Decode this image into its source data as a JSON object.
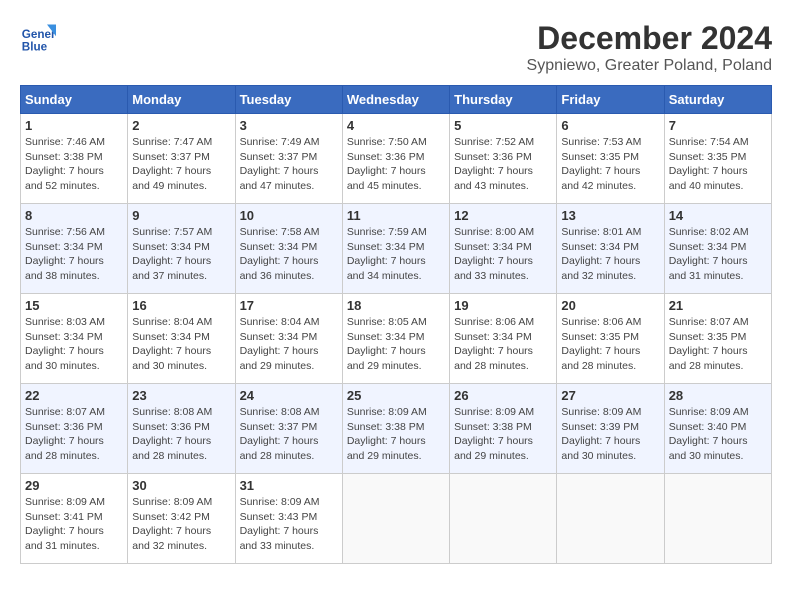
{
  "logo": {
    "text_line1": "General",
    "text_line2": "Blue"
  },
  "header": {
    "month": "December 2024",
    "location": "Sypniewo, Greater Poland, Poland"
  },
  "weekdays": [
    "Sunday",
    "Monday",
    "Tuesday",
    "Wednesday",
    "Thursday",
    "Friday",
    "Saturday"
  ],
  "weeks": [
    [
      {
        "day": "1",
        "info": "Sunrise: 7:46 AM\nSunset: 3:38 PM\nDaylight: 7 hours\nand 52 minutes."
      },
      {
        "day": "2",
        "info": "Sunrise: 7:47 AM\nSunset: 3:37 PM\nDaylight: 7 hours\nand 49 minutes."
      },
      {
        "day": "3",
        "info": "Sunrise: 7:49 AM\nSunset: 3:37 PM\nDaylight: 7 hours\nand 47 minutes."
      },
      {
        "day": "4",
        "info": "Sunrise: 7:50 AM\nSunset: 3:36 PM\nDaylight: 7 hours\nand 45 minutes."
      },
      {
        "day": "5",
        "info": "Sunrise: 7:52 AM\nSunset: 3:36 PM\nDaylight: 7 hours\nand 43 minutes."
      },
      {
        "day": "6",
        "info": "Sunrise: 7:53 AM\nSunset: 3:35 PM\nDaylight: 7 hours\nand 42 minutes."
      },
      {
        "day": "7",
        "info": "Sunrise: 7:54 AM\nSunset: 3:35 PM\nDaylight: 7 hours\nand 40 minutes."
      }
    ],
    [
      {
        "day": "8",
        "info": "Sunrise: 7:56 AM\nSunset: 3:34 PM\nDaylight: 7 hours\nand 38 minutes."
      },
      {
        "day": "9",
        "info": "Sunrise: 7:57 AM\nSunset: 3:34 PM\nDaylight: 7 hours\nand 37 minutes."
      },
      {
        "day": "10",
        "info": "Sunrise: 7:58 AM\nSunset: 3:34 PM\nDaylight: 7 hours\nand 36 minutes."
      },
      {
        "day": "11",
        "info": "Sunrise: 7:59 AM\nSunset: 3:34 PM\nDaylight: 7 hours\nand 34 minutes."
      },
      {
        "day": "12",
        "info": "Sunrise: 8:00 AM\nSunset: 3:34 PM\nDaylight: 7 hours\nand 33 minutes."
      },
      {
        "day": "13",
        "info": "Sunrise: 8:01 AM\nSunset: 3:34 PM\nDaylight: 7 hours\nand 32 minutes."
      },
      {
        "day": "14",
        "info": "Sunrise: 8:02 AM\nSunset: 3:34 PM\nDaylight: 7 hours\nand 31 minutes."
      }
    ],
    [
      {
        "day": "15",
        "info": "Sunrise: 8:03 AM\nSunset: 3:34 PM\nDaylight: 7 hours\nand 30 minutes."
      },
      {
        "day": "16",
        "info": "Sunrise: 8:04 AM\nSunset: 3:34 PM\nDaylight: 7 hours\nand 30 minutes."
      },
      {
        "day": "17",
        "info": "Sunrise: 8:04 AM\nSunset: 3:34 PM\nDaylight: 7 hours\nand 29 minutes."
      },
      {
        "day": "18",
        "info": "Sunrise: 8:05 AM\nSunset: 3:34 PM\nDaylight: 7 hours\nand 29 minutes."
      },
      {
        "day": "19",
        "info": "Sunrise: 8:06 AM\nSunset: 3:34 PM\nDaylight: 7 hours\nand 28 minutes."
      },
      {
        "day": "20",
        "info": "Sunrise: 8:06 AM\nSunset: 3:35 PM\nDaylight: 7 hours\nand 28 minutes."
      },
      {
        "day": "21",
        "info": "Sunrise: 8:07 AM\nSunset: 3:35 PM\nDaylight: 7 hours\nand 28 minutes."
      }
    ],
    [
      {
        "day": "22",
        "info": "Sunrise: 8:07 AM\nSunset: 3:36 PM\nDaylight: 7 hours\nand 28 minutes."
      },
      {
        "day": "23",
        "info": "Sunrise: 8:08 AM\nSunset: 3:36 PM\nDaylight: 7 hours\nand 28 minutes."
      },
      {
        "day": "24",
        "info": "Sunrise: 8:08 AM\nSunset: 3:37 PM\nDaylight: 7 hours\nand 28 minutes."
      },
      {
        "day": "25",
        "info": "Sunrise: 8:09 AM\nSunset: 3:38 PM\nDaylight: 7 hours\nand 29 minutes."
      },
      {
        "day": "26",
        "info": "Sunrise: 8:09 AM\nSunset: 3:38 PM\nDaylight: 7 hours\nand 29 minutes."
      },
      {
        "day": "27",
        "info": "Sunrise: 8:09 AM\nSunset: 3:39 PM\nDaylight: 7 hours\nand 30 minutes."
      },
      {
        "day": "28",
        "info": "Sunrise: 8:09 AM\nSunset: 3:40 PM\nDaylight: 7 hours\nand 30 minutes."
      }
    ],
    [
      {
        "day": "29",
        "info": "Sunrise: 8:09 AM\nSunset: 3:41 PM\nDaylight: 7 hours\nand 31 minutes."
      },
      {
        "day": "30",
        "info": "Sunrise: 8:09 AM\nSunset: 3:42 PM\nDaylight: 7 hours\nand 32 minutes."
      },
      {
        "day": "31",
        "info": "Sunrise: 8:09 AM\nSunset: 3:43 PM\nDaylight: 7 hours\nand 33 minutes."
      },
      {
        "day": "",
        "info": ""
      },
      {
        "day": "",
        "info": ""
      },
      {
        "day": "",
        "info": ""
      },
      {
        "day": "",
        "info": ""
      }
    ]
  ]
}
